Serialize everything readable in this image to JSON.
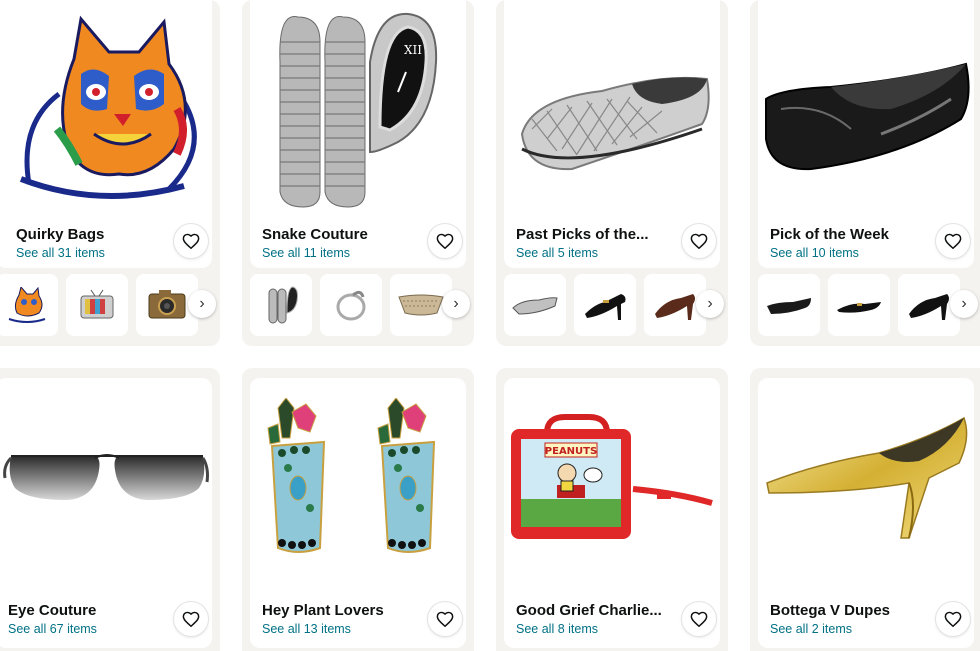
{
  "collections": [
    {
      "title": "Quirky Bags",
      "see_all": "See all 31 items",
      "hero_icon": "cat-bag-image",
      "thumbs": [
        "cat-bag-thumb",
        "tv-bag-thumb",
        "camera-bag-thumb"
      ]
    },
    {
      "title": "Snake Couture",
      "see_all": "See all 11 items",
      "hero_icon": "snake-watch-image",
      "thumbs": [
        "snake-watch-thumb",
        "snake-ring-thumb",
        "snakeskin-bag-thumb"
      ]
    },
    {
      "title": "Past Picks of the...",
      "see_all": "See all 5 items",
      "hero_icon": "woven-silver-mule-image",
      "thumbs": [
        "silver-mule-thumb",
        "black-heel-thumb",
        "brown-mule-thumb"
      ]
    },
    {
      "title": "Pick of the Week",
      "see_all": "See all 10 items",
      "hero_icon": "black-patent-flat-image",
      "thumbs": [
        "black-flat-thumb",
        "pointed-flat-thumb",
        "black-mule-thumb"
      ]
    },
    {
      "title": "Eye Couture",
      "see_all": "See all 67 items",
      "hero_icon": "rimless-sunglasses-image",
      "thumbs": []
    },
    {
      "title": "Hey Plant Lovers",
      "see_all": "See all 13 items",
      "hero_icon": "plant-earrings-image",
      "thumbs": []
    },
    {
      "title": "Good Grief Charlie...",
      "see_all": "See all 8 items",
      "hero_icon": "peanuts-lunchbox-bag-image",
      "thumbs": []
    },
    {
      "title": "Bottega V Dupes",
      "see_all": "See all 2 items",
      "hero_icon": "gold-sculpted-heel-image",
      "thumbs": []
    }
  ],
  "lunchbox_label": "PEANUTS",
  "colors": {
    "link": "#007185",
    "title": "#0f1111",
    "card_bg": "#f5f3ef"
  }
}
